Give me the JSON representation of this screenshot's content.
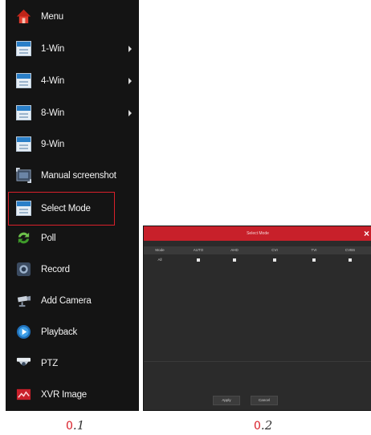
{
  "menu": {
    "items": [
      {
        "label": "Menu",
        "icon": "home-icon",
        "submenu": false
      },
      {
        "label": "1-Win",
        "icon": "window-icon",
        "submenu": true
      },
      {
        "label": "4-Win",
        "icon": "window-icon",
        "submenu": true
      },
      {
        "label": "8-Win",
        "icon": "window-icon",
        "submenu": true
      },
      {
        "label": "9-Win",
        "icon": "window-icon",
        "submenu": false
      },
      {
        "label": "Manual screenshot",
        "icon": "screenshot-icon",
        "submenu": false
      },
      {
        "label": "Select Mode",
        "icon": "window-icon",
        "submenu": false,
        "selected": true
      },
      {
        "label": "Poll",
        "icon": "poll-icon",
        "submenu": false
      },
      {
        "label": "Record",
        "icon": "record-icon",
        "submenu": false
      },
      {
        "label": "Add Camera",
        "icon": "add-camera-icon",
        "submenu": false
      },
      {
        "label": "Playback",
        "icon": "playback-icon",
        "submenu": false
      },
      {
        "label": "PTZ",
        "icon": "ptz-icon",
        "submenu": false
      },
      {
        "label": "XVR Image",
        "icon": "xvr-image-icon",
        "submenu": false
      }
    ],
    "selected_outline_color": "#d9202a"
  },
  "dialog": {
    "title": "Select Mode",
    "close_label": "×",
    "columns": [
      "Mode",
      "AUTO",
      "AHD",
      "CVI",
      "TVI",
      "CVBS"
    ],
    "row_label": "All",
    "apply_label": "Apply",
    "cancel_label": "Cancel",
    "title_color": "#c8202a"
  },
  "captions": {
    "left_num": "0",
    "left_text": ".1",
    "right_num": "0",
    "right_text": ".2"
  }
}
